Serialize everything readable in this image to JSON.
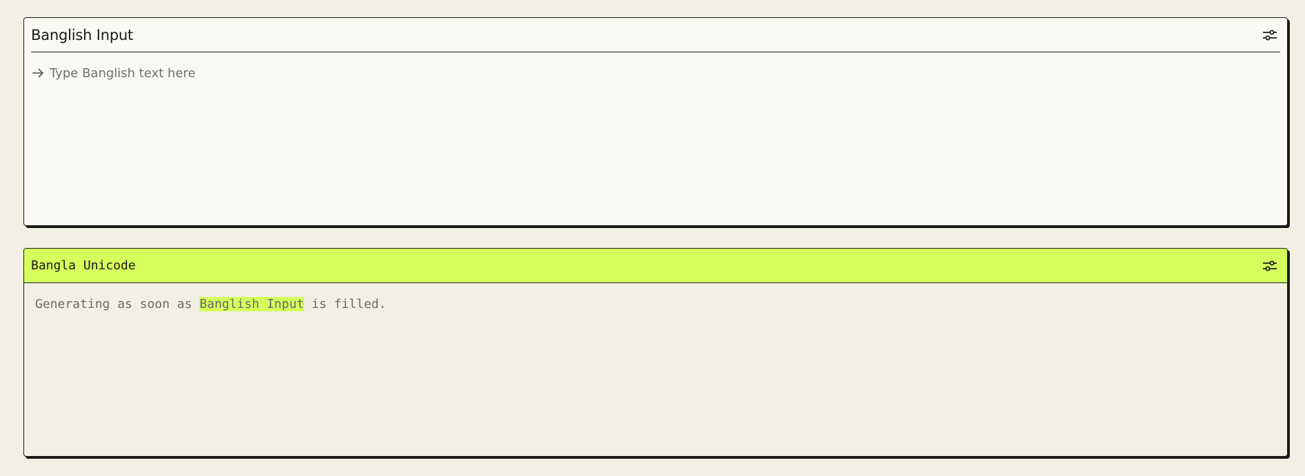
{
  "input_panel": {
    "title": "Banglish Input",
    "settings_icon": "sliders-icon",
    "arrow_icon": "arrow-right-icon",
    "placeholder": "Type Banglish text here",
    "value": ""
  },
  "output_panel": {
    "title": "Bangla Unicode",
    "settings_icon": "sliders-icon",
    "status_prefix": "Generating as soon as ",
    "status_highlight": "Banglish Input",
    "status_suffix": " is filled."
  },
  "colors": {
    "page_bg": "#f2f0e4",
    "input_bg": "#f9f8f3",
    "accent": "#d4ff5c",
    "border": "#1a1a1a"
  }
}
